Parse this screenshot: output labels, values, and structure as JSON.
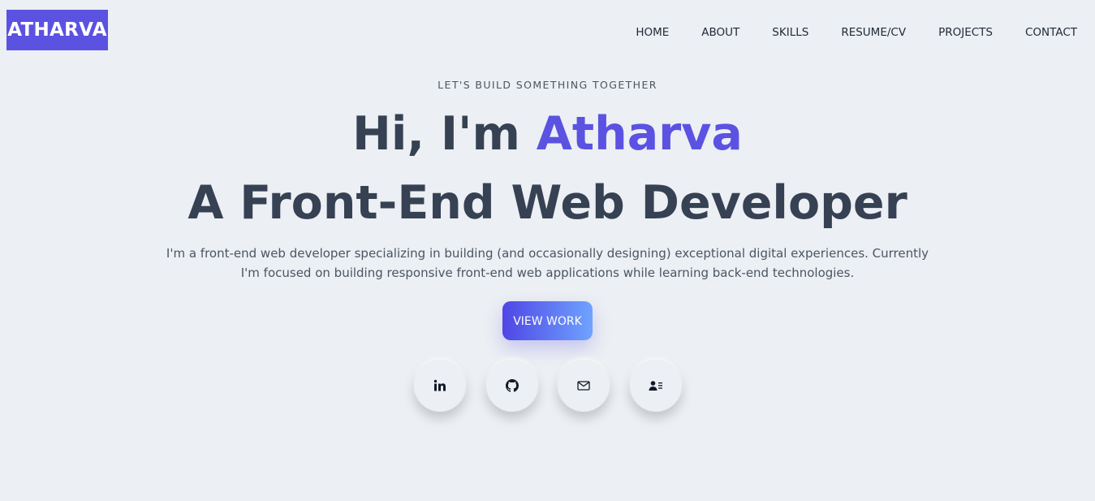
{
  "header": {
    "logo_text": "ATHARVA",
    "nav": [
      {
        "label": "HOME"
      },
      {
        "label": "ABOUT"
      },
      {
        "label": "SKILLS"
      },
      {
        "label": "RESUME/CV"
      },
      {
        "label": "PROJECTS"
      },
      {
        "label": "CONTACT"
      }
    ]
  },
  "hero": {
    "eyebrow": "LET'S BUILD SOMETHING TOGETHER",
    "greeting_prefix": "Hi, I'm ",
    "name": "Atharva",
    "role": "A Front-End Web Developer",
    "intro_line1": "I'm a front-end web developer specializing in building (and occasionally designing) exceptional digital experiences. Currently",
    "intro_line2": "I'm focused on building responsive front-end web applications while learning back-end technologies.",
    "cta_label": "VIEW WORK"
  },
  "socials": [
    {
      "icon": "linkedin-icon"
    },
    {
      "icon": "github-icon"
    },
    {
      "icon": "mail-icon"
    },
    {
      "icon": "contact-card-icon"
    }
  ],
  "colors": {
    "accent": "#5b52e2",
    "background": "#eceff3",
    "heading": "#364153",
    "cta_gradient_start": "#4f46e5",
    "cta_gradient_end": "#6fa3ff"
  }
}
